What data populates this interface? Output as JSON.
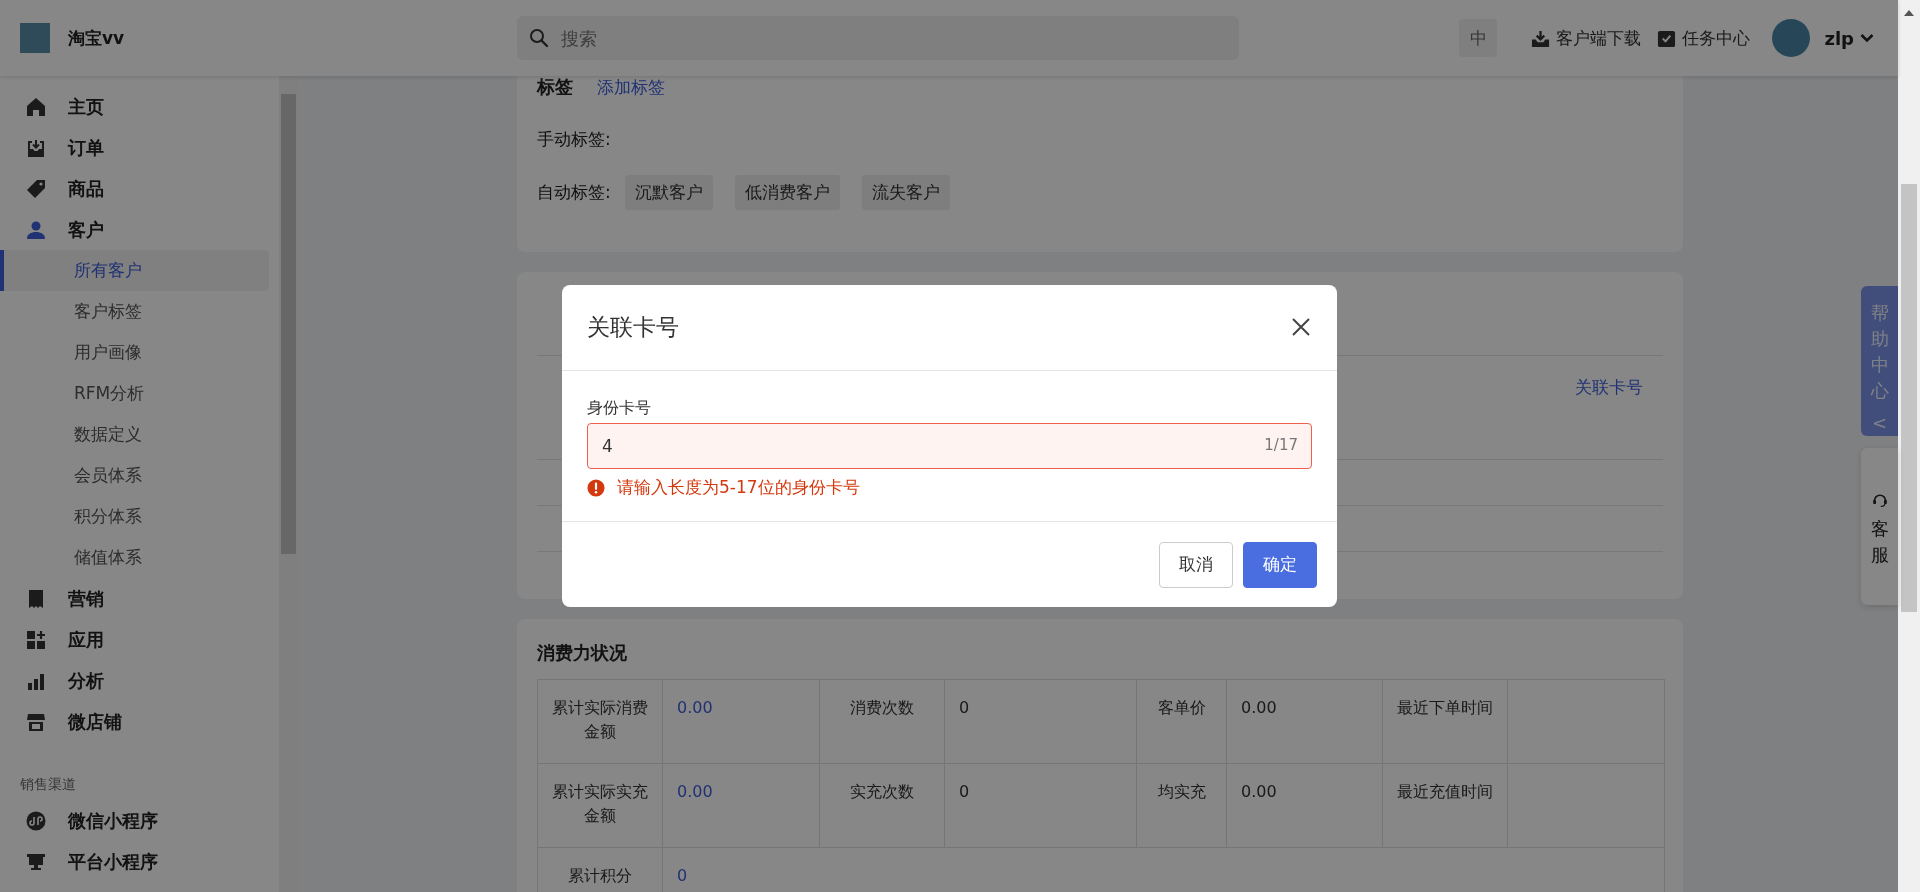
{
  "app": {
    "store_name": "淘宝vv"
  },
  "search": {
    "placeholder": "搜索"
  },
  "topbar": {
    "language": "中",
    "download": "客户端下载",
    "tasks": "任务中心",
    "user": "zlp"
  },
  "sidebar": {
    "items": [
      {
        "label": "主页",
        "selected": false
      },
      {
        "label": "订单",
        "selected": false
      },
      {
        "label": "商品",
        "selected": false
      },
      {
        "label": "客户",
        "selected": true,
        "expanded": true,
        "children": [
          {
            "label": "所有客户",
            "selected": true
          },
          {
            "label": "客户标签",
            "selected": false
          },
          {
            "label": "用户画像",
            "selected": false
          },
          {
            "label": "RFM分析",
            "selected": false
          },
          {
            "label": "数据定义",
            "selected": false
          },
          {
            "label": "会员体系",
            "selected": false
          },
          {
            "label": "积分体系",
            "selected": false
          },
          {
            "label": "储值体系",
            "selected": false
          }
        ]
      },
      {
        "label": "营销",
        "selected": false
      },
      {
        "label": "应用",
        "selected": false
      },
      {
        "label": "分析",
        "selected": false
      },
      {
        "label": "微店铺",
        "selected": false
      }
    ],
    "section_title": "销售渠道",
    "section_items": [
      {
        "label": "微信小程序",
        "selected": false
      },
      {
        "label": "平台小程序",
        "selected": false
      }
    ]
  },
  "tags_card": {
    "title": "标签",
    "add_link": "添加标签",
    "manual_label": "手动标签:",
    "auto_label": "自动标签:",
    "auto_tags": [
      "沉默客户",
      "低消费客户",
      "流失客户"
    ]
  },
  "card_card": {
    "link": "关联卡号"
  },
  "consumption": {
    "title": "消费力状况",
    "rows": [
      [
        {
          "label": "累计实际消费金额",
          "value": "0.00",
          "link": true
        },
        {
          "label": "消费次数",
          "value": "0",
          "link": false
        },
        {
          "label": "客单价",
          "value": "0.00",
          "link": false
        },
        {
          "label": "最近下单时间"
        }
      ],
      [
        {
          "label": "累计实际实充金额",
          "value": "0.00",
          "link": true
        },
        {
          "label": "实充次数",
          "value": "0",
          "link": false
        },
        {
          "label": "均实充",
          "value": "0.00",
          "link": false
        },
        {
          "label": "最近充值时间"
        }
      ],
      [
        {
          "label": "累计积分",
          "value": "0",
          "link": true
        }
      ]
    ]
  },
  "dialog": {
    "title": "关联卡号",
    "field_label": "身份卡号",
    "value": "4",
    "counter": "1/17",
    "invalid": true,
    "error": "请输入长度为5-17位的身份卡号",
    "buttons": [
      {
        "label": "取消",
        "kind": "default"
      },
      {
        "label": "确定",
        "kind": "primary"
      }
    ]
  },
  "help": {
    "help_center": "帮助中心",
    "collapse": "<",
    "service": "客服"
  }
}
